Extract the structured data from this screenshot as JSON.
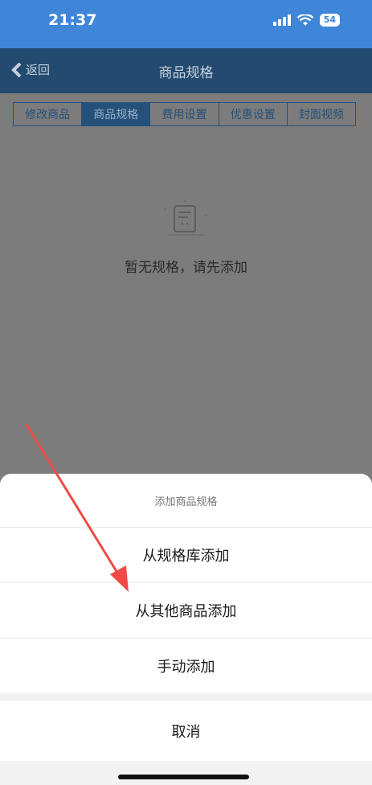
{
  "status_bar": {
    "time": "21:37",
    "battery": "54",
    "icons": [
      "signal-icon",
      "wifi-icon",
      "battery-icon"
    ]
  },
  "nav": {
    "back_label": "返回",
    "title": "商品规格"
  },
  "tabs": [
    {
      "label": "修改商品",
      "active": false
    },
    {
      "label": "商品规格",
      "active": true
    },
    {
      "label": "费用设置",
      "active": false
    },
    {
      "label": "优惠设置",
      "active": false
    },
    {
      "label": "封面视频",
      "active": false
    }
  ],
  "empty_state": {
    "icon": "empty-document-icon",
    "text": "暂无规格，请先添加"
  },
  "action_sheet": {
    "title": "添加商品规格",
    "options": [
      {
        "label": "从规格库添加"
      },
      {
        "label": "从其他商品添加"
      },
      {
        "label": "手动添加"
      }
    ],
    "cancel_label": "取消"
  },
  "colors": {
    "status_bar_bg": "#3f86d9",
    "nav_bar_bg": "#234a6f",
    "overlay_bg": "#7c7c7c",
    "annotation_arrow": "#f04a45"
  }
}
